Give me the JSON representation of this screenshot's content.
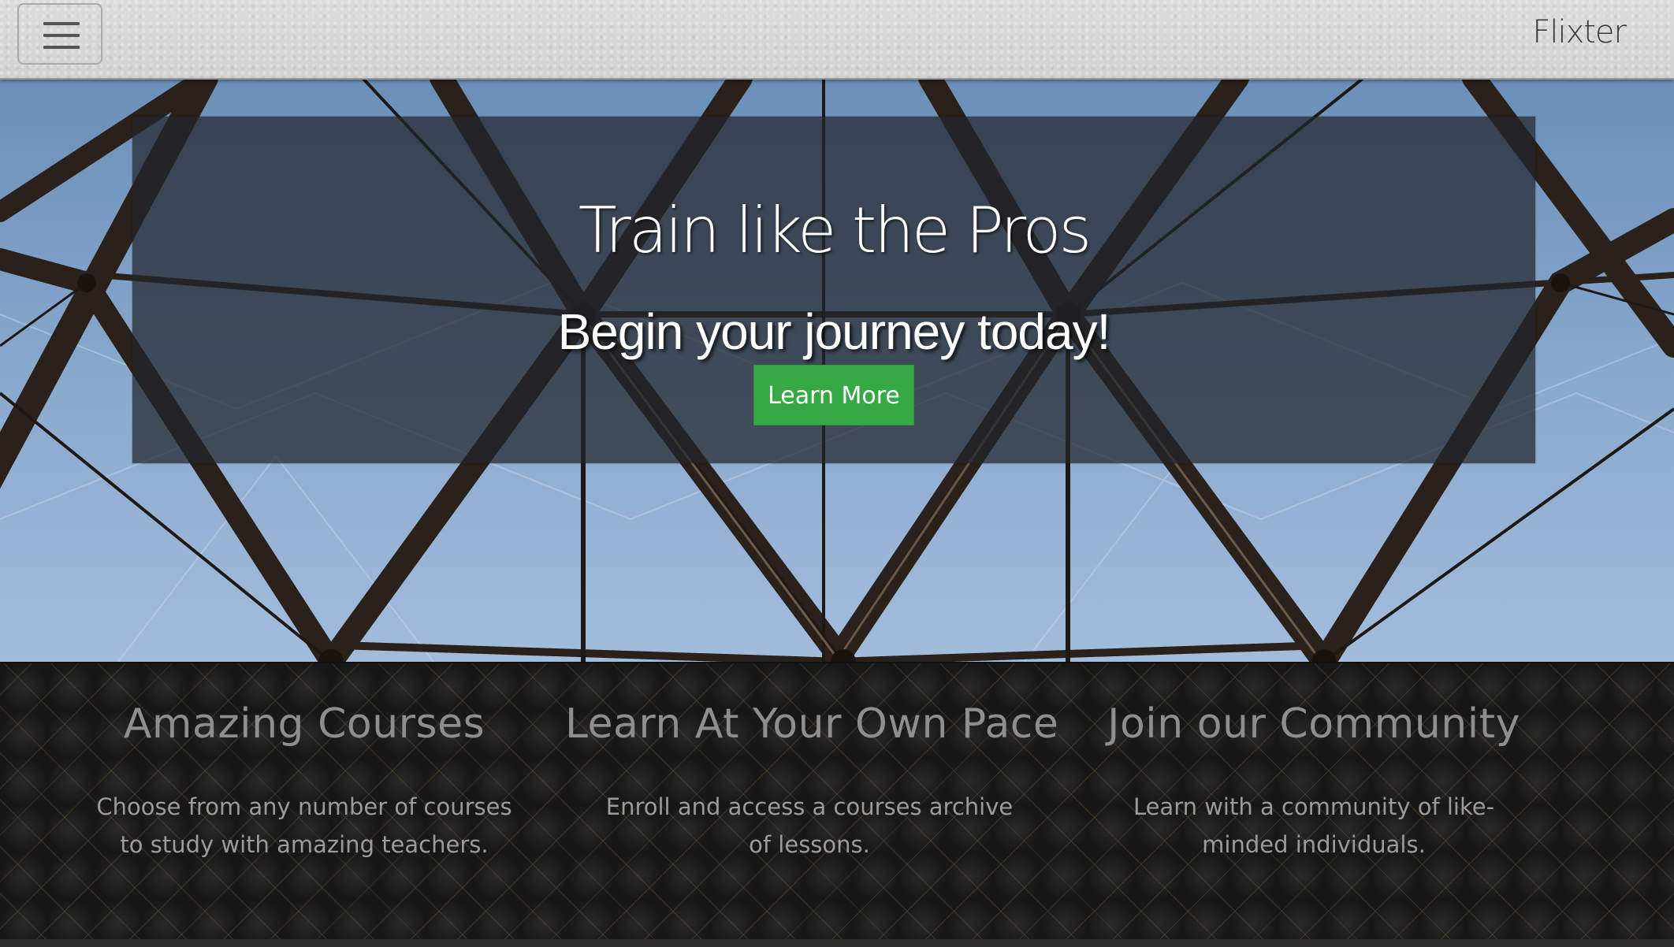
{
  "navbar": {
    "brand": "Flixter",
    "menu_toggle_icon": "hamburger-menu-icon"
  },
  "hero": {
    "title": "Train like the Pros",
    "subtitle": "Begin your journey today!",
    "cta_label": "Learn More"
  },
  "features": [
    {
      "heading": "Amazing Courses",
      "text": "Choose from any number of courses to study with amazing teachers."
    },
    {
      "heading": "Learn At Your Own Pace",
      "text": "Enroll and access a courses archive of lessons."
    },
    {
      "heading": "Join our Community",
      "text": "Learn with a community of like-minded individuals."
    }
  ],
  "colors": {
    "cta_background": "#36a845",
    "navbar_background": "#d6d6d6",
    "hero_panel": "#22262c",
    "feature_text": "#9b9b9b"
  }
}
